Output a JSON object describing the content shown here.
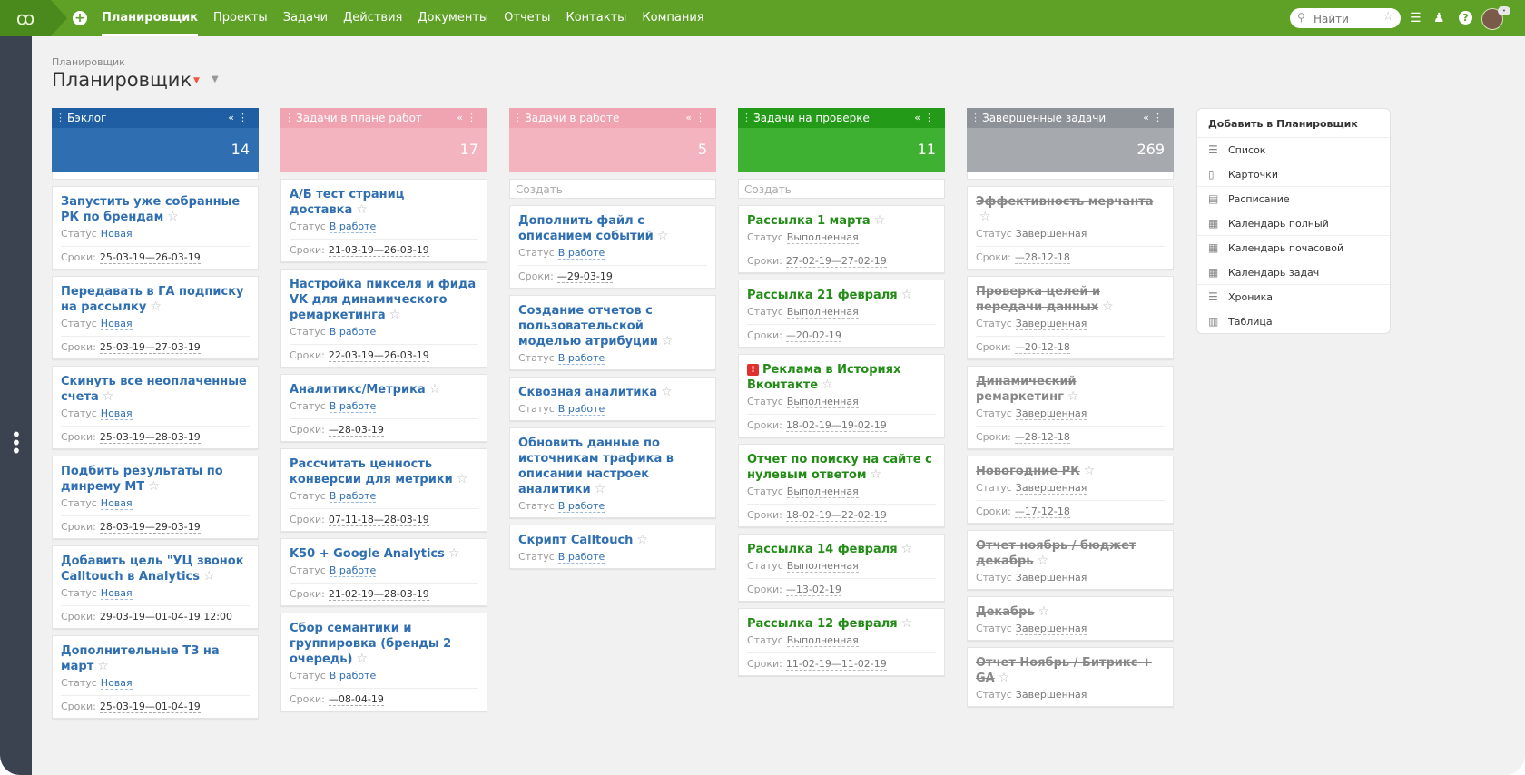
{
  "topbar": {
    "nav": [
      "Планировщик",
      "Проекты",
      "Задачи",
      "Действия",
      "Документы",
      "Отчеты",
      "Контакты",
      "Компания"
    ],
    "search_placeholder": "Найти"
  },
  "header": {
    "breadcrumb": "Планировщик",
    "title": "Планировщик"
  },
  "columns": {
    "backlog": {
      "title": "Бэклог",
      "count": "14",
      "cards": [
        {
          "title": "Запустить уже собранные РК по брендам",
          "status_label": "Статус",
          "status": "Новая",
          "dates_label": "Сроки:",
          "dates": "25-03-19—26-03-19"
        },
        {
          "title": "Передавать в ГА подписку на рассылку",
          "status_label": "Статус",
          "status": "Новая",
          "dates_label": "Сроки:",
          "dates": "25-03-19—27-03-19"
        },
        {
          "title": "Скинуть все неоплаченные счета",
          "status_label": "Статус",
          "status": "Новая",
          "dates_label": "Сроки:",
          "dates": "25-03-19—28-03-19"
        },
        {
          "title": "Подбить результаты по динрему МТ",
          "status_label": "Статус",
          "status": "Новая",
          "dates_label": "Сроки:",
          "dates": "28-03-19—29-03-19"
        },
        {
          "title": "Добавить цель \"УЦ звонок Calltouch в Analytics",
          "status_label": "Статус",
          "status": "Новая",
          "dates_label": "Сроки:",
          "dates": "29-03-19—01-04-19 12:00"
        },
        {
          "title": "Дополнительные ТЗ на март",
          "status_label": "Статус",
          "status": "Новая",
          "dates_label": "Сроки:",
          "dates": "25-03-19—01-04-19"
        }
      ]
    },
    "plan": {
      "title": "Задачи в плане работ",
      "count": "17",
      "cards": [
        {
          "title": "А/Б тест страниц доставка",
          "status_label": "Статус",
          "status": "В работе",
          "dates_label": "Сроки:",
          "dates": "21-03-19—26-03-19"
        },
        {
          "title": "Настройка пикселя и фида VK для динамического ремаркетинга",
          "status_label": "Статус",
          "status": "В работе",
          "dates_label": "Сроки:",
          "dates": "22-03-19—26-03-19"
        },
        {
          "title": "Аналитикс/Метрика",
          "status_label": "Статус",
          "status": "В работе",
          "dates_label": "Сроки:",
          "dates": "—28-03-19"
        },
        {
          "title": "Рассчитать ценность конверсии для метрики",
          "status_label": "Статус",
          "status": "В работе",
          "dates_label": "Сроки:",
          "dates": "07-11-18—28-03-19"
        },
        {
          "title": "K50 + Google Analytics",
          "status_label": "Статус",
          "status": "В работе",
          "dates_label": "Сроки:",
          "dates": "21-02-19—28-03-19"
        },
        {
          "title": "Сбор семантики и группировка (бренды 2 очередь)",
          "status_label": "Статус",
          "status": "В работе",
          "dates_label": "Сроки:",
          "dates": "—08-04-19"
        }
      ]
    },
    "work": {
      "title": "Задачи в работе",
      "count": "5",
      "create": "Создать",
      "cards": [
        {
          "title": "Дополнить файл с описанием событий",
          "status_label": "Статус",
          "status": "В работе",
          "dates_label": "Сроки:",
          "dates": "—29-03-19"
        },
        {
          "title": "Создание отчетов с пользовательской моделью атрибуции",
          "status_label": "Статус",
          "status": "В работе"
        },
        {
          "title": "Сквозная аналитика",
          "status_label": "Статус",
          "status": "В работе"
        },
        {
          "title": "Обновить данные по источникам трафика в описании настроек аналитики",
          "status_label": "Статус",
          "status": "В работе"
        },
        {
          "title": "Скрипт Calltouch",
          "status_label": "Статус",
          "status": "В работе"
        }
      ]
    },
    "review": {
      "title": "Задачи на проверке",
      "count": "11",
      "create": "Создать",
      "cards": [
        {
          "title": "Рассылка 1 марта",
          "status_label": "Статус",
          "status": "Выполненная",
          "dates_label": "Сроки:",
          "dates": "27-02-19—27-02-19"
        },
        {
          "title": "Рассылка 21 февраля",
          "status_label": "Статус",
          "status": "Выполненная",
          "dates_label": "Сроки:",
          "dates": "—20-02-19"
        },
        {
          "title": "Реклама в Историях Вконтакте",
          "status_label": "Статус",
          "status": "Выполненная",
          "dates_label": "Сроки:",
          "dates": "18-02-19—19-02-19",
          "urgent": true
        },
        {
          "title": "Отчет по поиску на сайте с нулевым ответом",
          "status_label": "Статус",
          "status": "Выполненная",
          "dates_label": "Сроки:",
          "dates": "18-02-19—22-02-19"
        },
        {
          "title": "Рассылка 14 февраля",
          "status_label": "Статус",
          "status": "Выполненная",
          "dates_label": "Сроки:",
          "dates": "—13-02-19"
        },
        {
          "title": "Рассылка 12 февраля",
          "status_label": "Статус",
          "status": "Выполненная",
          "dates_label": "Сроки:",
          "dates": "11-02-19—11-02-19"
        }
      ]
    },
    "done": {
      "title": "Завершенные задачи",
      "count": "269",
      "cards": [
        {
          "title": "Эффективность мерчанта",
          "status_label": "Статус",
          "status": "Завершенная",
          "dates_label": "Сроки:",
          "dates": "—28-12-18"
        },
        {
          "title": "Проверка целей и передачи данных",
          "status_label": "Статус",
          "status": "Завершенная",
          "dates_label": "Сроки:",
          "dates": "—20-12-18"
        },
        {
          "title": "Динамический ремаркетинг",
          "status_label": "Статус",
          "status": "Завершенная",
          "dates_label": "Сроки:",
          "dates": "—28-12-18"
        },
        {
          "title": "Новогодние РК",
          "status_label": "Статус",
          "status": "Завершенная",
          "dates_label": "Сроки:",
          "dates": "—17-12-18"
        },
        {
          "title": "Отчет ноябрь / бюджет декабрь",
          "status_label": "Статус",
          "status": "Завершенная"
        },
        {
          "title": "Декабрь",
          "status_label": "Статус",
          "status": "Завершенная"
        },
        {
          "title": "Отчет Ноябрь / Битрикс + GA",
          "status_label": "Статус",
          "status": "Завершенная"
        }
      ]
    }
  },
  "add_panel": {
    "title": "Добавить в Планировщик",
    "items": [
      "Список",
      "Карточки",
      "Расписание",
      "Календарь полный",
      "Календарь почасовой",
      "Календарь задач",
      "Хроника",
      "Таблица"
    ]
  },
  "colors": {
    "topbar": "#5fa126",
    "backlog": "#1f5ea2",
    "plan": "#f0a3b0",
    "review": "#249a19",
    "done": "#8d9299",
    "link": "#2f6fb1"
  }
}
